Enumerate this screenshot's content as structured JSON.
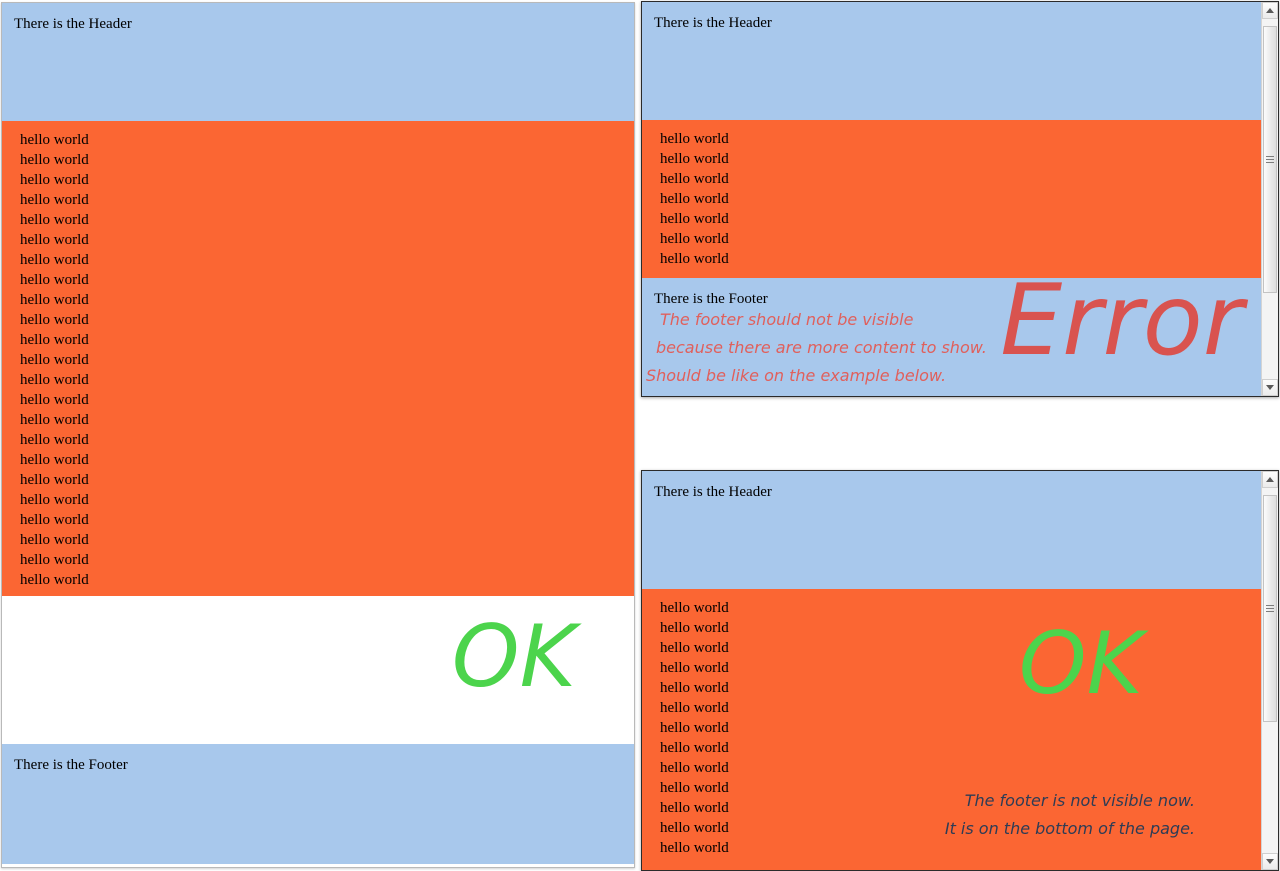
{
  "common": {
    "header_text": "There is the Header",
    "footer_text": "There is the Footer",
    "hello_text": "hello world",
    "colors": {
      "header_blue": "#a8c8ec",
      "content_orange": "#fb6633",
      "ok_green": "#4cd44c",
      "error_red": "#d9534f",
      "note_error_red": "#e0605c",
      "note_ok_navy": "#2e3c55",
      "page_white": "#ffffff"
    }
  },
  "panels": {
    "full": {
      "name": "full-page-example",
      "header": "There is the Header",
      "footer": "There is the Footer",
      "hello_count": 23,
      "hello_lines": [
        "hello world",
        "hello world",
        "hello world",
        "hello world",
        "hello world",
        "hello world",
        "hello world",
        "hello world",
        "hello world",
        "hello world",
        "hello world",
        "hello world",
        "hello world",
        "hello world",
        "hello world",
        "hello world",
        "hello world",
        "hello world",
        "hello world",
        "hello world",
        "hello world",
        "hello world",
        "hello world"
      ],
      "stamp": "OK",
      "has_scrollbar": false
    },
    "error": {
      "name": "error-example",
      "header": "There is the Header",
      "footer": "There is the Footer",
      "hello_count": 7,
      "hello_lines": [
        "hello world",
        "hello world",
        "hello world",
        "hello world",
        "hello world",
        "hello world",
        "hello world"
      ],
      "stamp": "Error",
      "notes": [
        "The footer should not be visible",
        "because there are more content to show.",
        "Should be like on the example below."
      ],
      "has_scrollbar": true,
      "scrollbar": {
        "thumb_top_pct": 2,
        "thumb_height_pct": 74
      }
    },
    "ok": {
      "name": "ok-example",
      "header": "There is the Header",
      "hello_count": 13,
      "hello_lines": [
        "hello world",
        "hello world",
        "hello world",
        "hello world",
        "hello world",
        "hello world",
        "hello world",
        "hello world",
        "hello world",
        "hello world",
        "hello world",
        "hello world",
        "hello world"
      ],
      "stamp": "OK",
      "notes": [
        "The footer is not visible now.",
        "It is on the bottom of the page."
      ],
      "has_scrollbar": true,
      "scrollbar": {
        "thumb_top_pct": 2,
        "thumb_height_pct": 62
      }
    }
  }
}
